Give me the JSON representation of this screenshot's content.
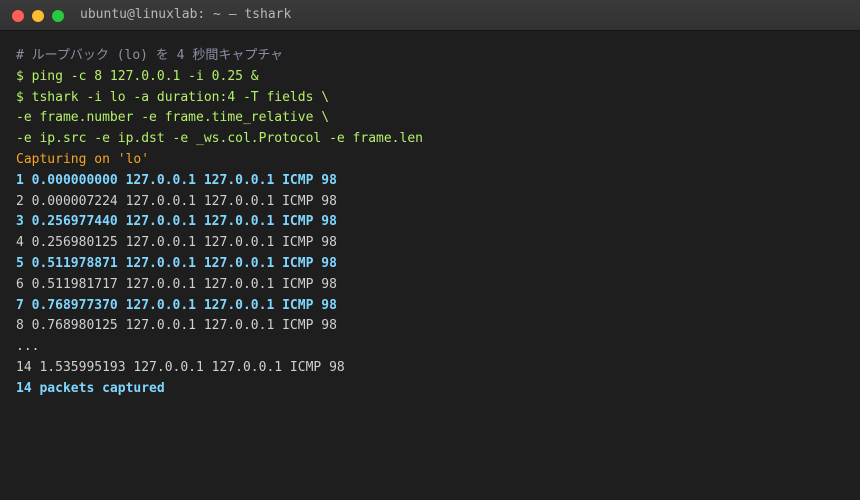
{
  "window": {
    "title": "ubuntu@linuxlab: ~ — tshark",
    "colors": {
      "close": "#ff5f57",
      "minimize": "#febc2e",
      "maximize": "#28c840",
      "background": "#1e1e1e"
    }
  },
  "terminal": {
    "lines": [
      {
        "text": "# ループバック (lo) を 4 秒間キャプチャ",
        "style": "comment"
      },
      {
        "text": "$ ping -c 8 127.0.0.1 -i 0.25 &",
        "style": "cmd"
      },
      {
        "text": "$ tshark -i lo -a duration:4 -T fields \\",
        "style": "cmd"
      },
      {
        "text": "-e frame.number -e frame.time_relative \\",
        "style": "cmd"
      },
      {
        "text": "-e ip.src -e ip.dst -e _ws.col.Protocol -e frame.len",
        "style": "cmd"
      },
      {
        "text": "Capturing on 'lo'",
        "style": "status"
      },
      {
        "text": "1 0.000000000 127.0.0.1 127.0.0.1 ICMP 98",
        "style": "hl"
      },
      {
        "text": "2 0.000007224 127.0.0.1 127.0.0.1 ICMP 98",
        "style": "plain"
      },
      {
        "text": "3 0.256977440 127.0.0.1 127.0.0.1 ICMP 98",
        "style": "hl"
      },
      {
        "text": "4 0.256980125 127.0.0.1 127.0.0.1 ICMP 98",
        "style": "plain"
      },
      {
        "text": "5 0.511978871 127.0.0.1 127.0.0.1 ICMP 98",
        "style": "hl"
      },
      {
        "text": "6 0.511981717 127.0.0.1 127.0.0.1 ICMP 98",
        "style": "plain"
      },
      {
        "text": "7 0.768977370 127.0.0.1 127.0.0.1 ICMP 98",
        "style": "hl"
      },
      {
        "text": "8 0.768980125 127.0.0.1 127.0.0.1 ICMP 98",
        "style": "plain"
      },
      {
        "text": "...",
        "style": "plain"
      },
      {
        "text": "14 1.535995193 127.0.0.1 127.0.0.1 ICMP 98",
        "style": "plain"
      },
      {
        "text": "14 packets captured",
        "style": "hl"
      }
    ]
  }
}
